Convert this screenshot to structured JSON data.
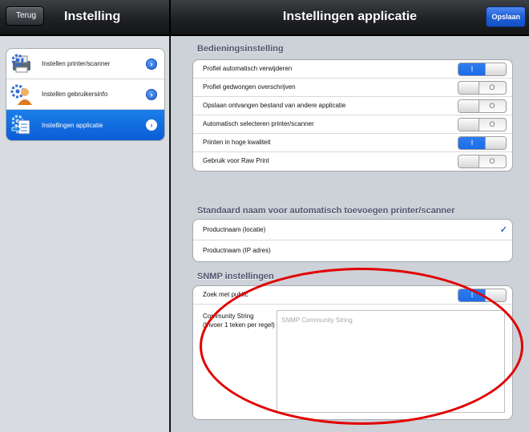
{
  "left_nav": {
    "back_label": "Terug",
    "title": "Instelling"
  },
  "right_nav": {
    "title": "Instellingen applicatie",
    "save_label": "Opslaan"
  },
  "sidebar": {
    "items": [
      {
        "label": "Instellen printer/scanner",
        "icon": "printer-settings-icon",
        "selected": false
      },
      {
        "label": "Instellen gebruikersinfo",
        "icon": "user-settings-icon",
        "selected": false
      },
      {
        "label": "Instellingen applicatie",
        "icon": "app-settings-icon",
        "selected": true
      }
    ]
  },
  "operation": {
    "header": "Bedieningsinstelling",
    "rows": [
      {
        "label": "Profiel automatisch verwijderen",
        "on": true
      },
      {
        "label": "Profiel gedwongen overschrijven",
        "on": false
      },
      {
        "label": "Opslaan ontvangen bestand van andere applicatie",
        "on": false
      },
      {
        "label": "Automatisch selecteren printer/scanner",
        "on": false
      },
      {
        "label": "Printen in hoge kwaliteit",
        "on": true
      },
      {
        "label": "Gebruik voor Raw Print",
        "on": false
      }
    ],
    "toggle_on_glyph": "I",
    "toggle_off_glyph": "O"
  },
  "naming": {
    "header": "Standaard naam voor automatisch toevoegen printer/scanner",
    "options": [
      {
        "label": "Productnaam (locatie)",
        "checked": true
      },
      {
        "label": "Productnaam (IP adres)",
        "checked": false
      }
    ],
    "check_glyph": "✓"
  },
  "snmp": {
    "header": "SNMP instellingen",
    "search_public_label": "Zoek met public",
    "search_public_on": true,
    "community_label": "Community String (Invoer 1 teken per regel)",
    "community_placeholder": "SNMP Community String",
    "community_value": ""
  },
  "annotation": {
    "color": "#e10000",
    "shape": "ellipse"
  }
}
